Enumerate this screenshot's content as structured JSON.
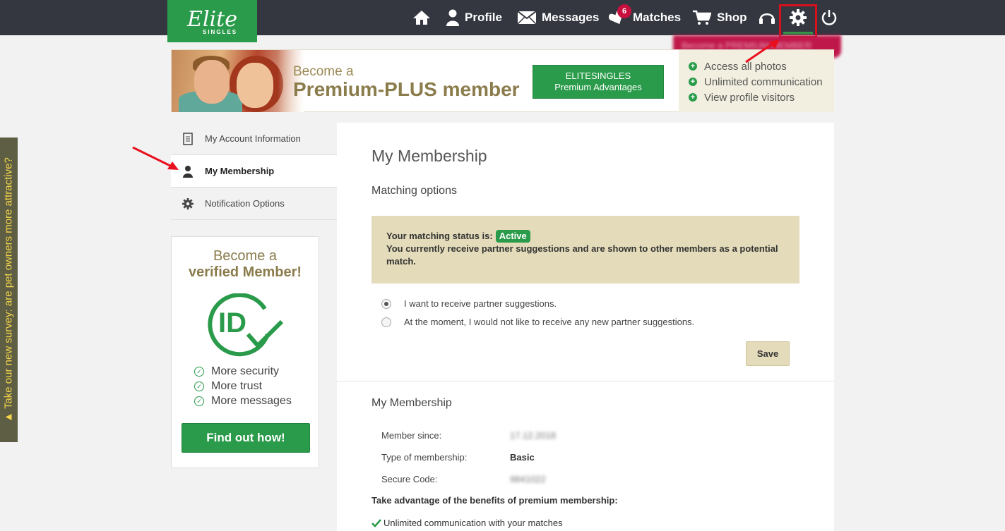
{
  "header": {
    "logo": {
      "brand": "Elite",
      "sub": "SINGLES"
    },
    "nav": {
      "profile": "Profile",
      "messages": "Messages",
      "matches": "Matches",
      "matches_badge": "6",
      "shop": "Shop"
    },
    "promo_blurred": "Become a PREMIUM MEMBER"
  },
  "banner": {
    "become": "Become a",
    "premium": "Premium-PLUS member",
    "button_line1": "ELITESINGLES",
    "button_line2": "Premium Advantages",
    "benefits": [
      "Access all photos",
      "Unlimited communication",
      "View profile visitors"
    ]
  },
  "sidebar": {
    "items": [
      {
        "label": "My Account Information"
      },
      {
        "label": "My Membership"
      },
      {
        "label": "Notification Options"
      }
    ]
  },
  "verify_card": {
    "line1": "Become a",
    "line2": "verified Member!",
    "logo_text": "ID",
    "points": [
      "More security",
      "More trust",
      "More messages"
    ],
    "button": "Find out how!"
  },
  "survey_tab": "▲ Take our new survey: are pet owners more attractive?",
  "main": {
    "title": "My Membership",
    "matching_title": "Matching options",
    "status_label": "Your matching status is:",
    "status_value": "Active",
    "status_desc": "You currently receive partner suggestions and are shown to other members as a potential match.",
    "radio_options": [
      {
        "label": "I want to receive partner suggestions.",
        "checked": true
      },
      {
        "label": "At the moment, I would not like to receive any new partner suggestions.",
        "checked": false
      }
    ],
    "save": "Save",
    "membership_title": "My Membership",
    "member_since_label": "Member since:",
    "member_since_value": "17.12.2018",
    "type_label": "Type of membership:",
    "type_value": "Basic",
    "secure_label": "Secure Code:",
    "secure_value": "9841022",
    "benefits_title": "Take advantage of the benefits of premium membership:",
    "benefit_1": "Unlimited communication with your matches"
  },
  "colors": {
    "brand_green": "#2a9b4a",
    "topbar": "#343740",
    "badge_red": "#c8103e",
    "highlight_red": "#d9101e",
    "status_beige": "#e3dbb9",
    "gold_text": "#8b7c4c"
  },
  "icons": [
    "home-icon",
    "user-icon",
    "envelope-icon",
    "heart-icon",
    "cart-icon",
    "support-icon",
    "gear-icon",
    "power-icon",
    "document-icon",
    "person-icon",
    "plus-circle-icon",
    "check-circle-icon",
    "id-badge-icon",
    "check-icon"
  ]
}
